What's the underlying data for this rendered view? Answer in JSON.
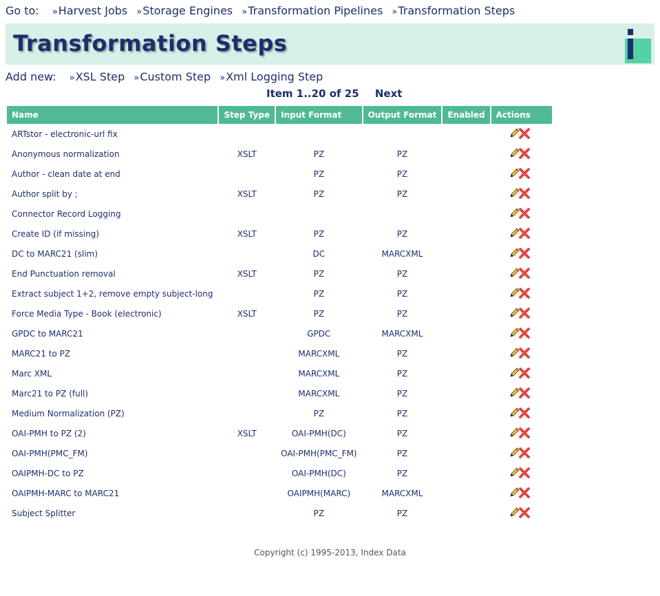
{
  "goto": {
    "label": "Go to:",
    "links": [
      "Harvest Jobs",
      "Storage Engines",
      "Transformation Pipelines",
      "Transformation Steps"
    ]
  },
  "page_title": "Transformation Steps",
  "add_new": {
    "label": "Add new:",
    "links": [
      "XSL Step",
      "Custom Step",
      "Xml Logging Step"
    ]
  },
  "pager": {
    "range": "Item 1..20 of 25",
    "next": "Next"
  },
  "table": {
    "headers": [
      "Name",
      "Step Type",
      "Input Format",
      "Output Format",
      "Enabled",
      "Actions"
    ],
    "rows": [
      {
        "name": "ARTstor - electronic-url fix",
        "type": "",
        "input": "",
        "output": "",
        "enabled": ""
      },
      {
        "name": "Anonymous normalization",
        "type": "XSLT",
        "input": "PZ",
        "output": "PZ",
        "enabled": ""
      },
      {
        "name": "Author - clean date at end",
        "type": "",
        "input": "PZ",
        "output": "PZ",
        "enabled": ""
      },
      {
        "name": "Author split by ;",
        "type": "XSLT",
        "input": "PZ",
        "output": "PZ",
        "enabled": ""
      },
      {
        "name": "Connector Record Logging",
        "type": "",
        "input": "",
        "output": "",
        "enabled": ""
      },
      {
        "name": "Create ID (if missing)",
        "type": "XSLT",
        "input": "PZ",
        "output": "PZ",
        "enabled": ""
      },
      {
        "name": "DC to MARC21 (slim)",
        "type": "",
        "input": "DC",
        "output": "MARCXML",
        "enabled": ""
      },
      {
        "name": "End Punctuation removal",
        "type": "XSLT",
        "input": "PZ",
        "output": "PZ",
        "enabled": ""
      },
      {
        "name": "Extract subject 1+2, remove empty subject-long",
        "type": "",
        "input": "PZ",
        "output": "PZ",
        "enabled": ""
      },
      {
        "name": "Force Media Type - Book (electronic)",
        "type": "XSLT",
        "input": "PZ",
        "output": "PZ",
        "enabled": ""
      },
      {
        "name": "GPDC to MARC21",
        "type": "",
        "input": "GPDC",
        "output": "MARCXML",
        "enabled": ""
      },
      {
        "name": "MARC21 to PZ",
        "type": "",
        "input": "MARCXML",
        "output": "PZ",
        "enabled": ""
      },
      {
        "name": "Marc XML",
        "type": "",
        "input": "MARCXML",
        "output": "PZ",
        "enabled": ""
      },
      {
        "name": "Marc21 to PZ (full)",
        "type": "",
        "input": "MARCXML",
        "output": "PZ",
        "enabled": ""
      },
      {
        "name": "Medium Normalization (PZ)",
        "type": "",
        "input": "PZ",
        "output": "PZ",
        "enabled": ""
      },
      {
        "name": "OAI-PMH to PZ (2)",
        "type": "XSLT",
        "input": "OAI-PMH(DC)",
        "output": "PZ",
        "enabled": ""
      },
      {
        "name": "OAI-PMH(PMC_FM)",
        "type": "",
        "input": "OAI-PMH(PMC_FM)",
        "output": "PZ",
        "enabled": ""
      },
      {
        "name": "OAIPMH-DC to PZ",
        "type": "",
        "input": "OAI-PMH(DC)",
        "output": "PZ",
        "enabled": ""
      },
      {
        "name": "OAIPMH-MARC to MARC21",
        "type": "",
        "input": "OAIPMH(MARC)",
        "output": "MARCXML",
        "enabled": ""
      },
      {
        "name": "Subject Splitter",
        "type": "",
        "input": "PZ",
        "output": "PZ",
        "enabled": ""
      }
    ]
  },
  "footer": "Copyright (c) 1995-2013, Index Data",
  "colors": {
    "header_band": "#d8f0e7",
    "table_header": "#4fba93",
    "text": "#1c2e6e",
    "logo_accent": "#55d1a3"
  },
  "icons": {
    "edit": "pencil-icon",
    "delete": "red-x-icon",
    "logo": "info-logo-icon"
  }
}
